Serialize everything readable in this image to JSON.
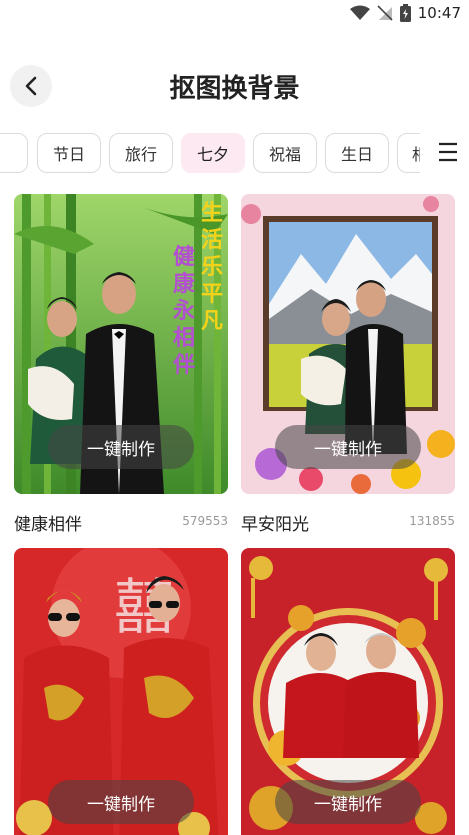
{
  "status": {
    "time": "10:47"
  },
  "header": {
    "title": "抠图换背景"
  },
  "tabs": [
    {
      "label": ""
    },
    {
      "label": "节日"
    },
    {
      "label": "旅行"
    },
    {
      "label": "七夕"
    },
    {
      "label": "祝福"
    },
    {
      "label": "生日"
    },
    {
      "label": "相"
    }
  ],
  "active_tab": "七夕",
  "cards": [
    {
      "name": "健康相伴",
      "count": "579553",
      "button": "一键制作",
      "caption_col1": "生活乐平凡",
      "caption_col2": "健康永相伴"
    },
    {
      "name": "早安阳光",
      "count": "131855",
      "button": "一键制作"
    },
    {
      "name": "",
      "count": "",
      "button": "一键制作"
    },
    {
      "name": "",
      "count": "",
      "button": "一键制作"
    }
  ],
  "colors": {
    "active_tab_bg": "#fde9f1",
    "text": "#222222",
    "muted": "#999999"
  }
}
